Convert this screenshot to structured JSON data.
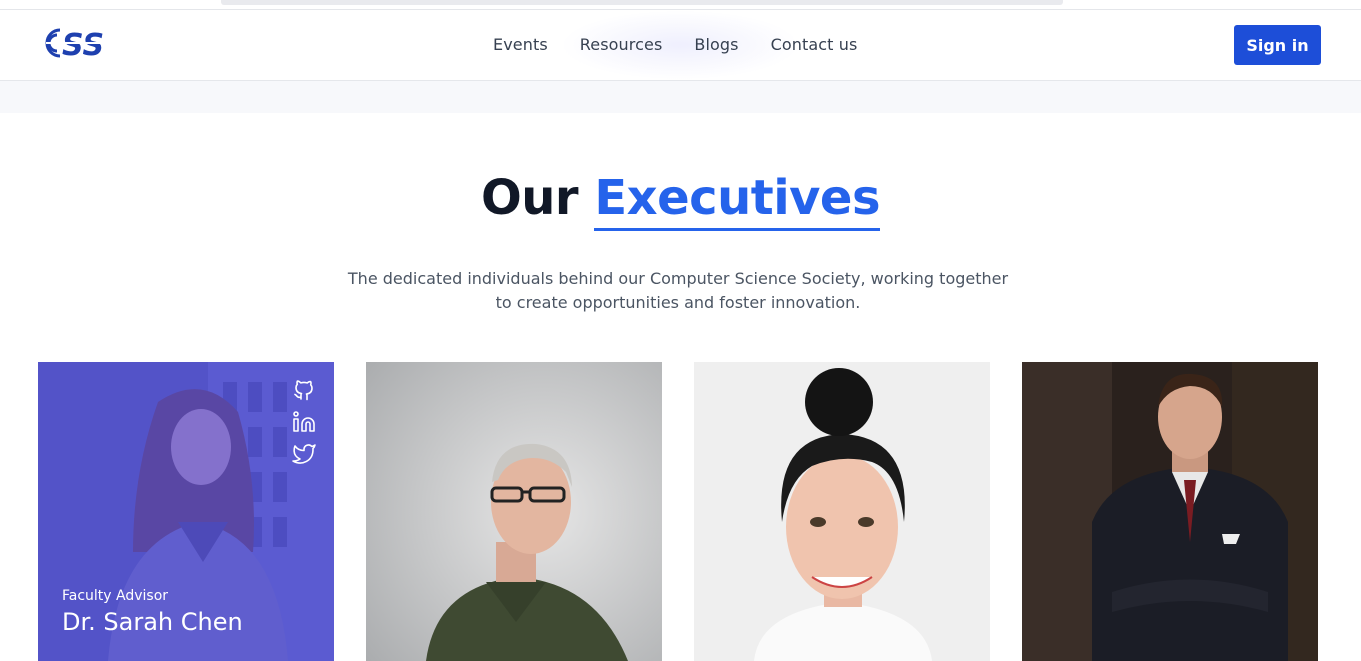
{
  "header": {
    "logo_alt": "CSS",
    "nav": [
      "Events",
      "Resources",
      "Blogs",
      "Contact us"
    ],
    "signin_label": "Sign in"
  },
  "section": {
    "title_plain": "Our",
    "title_accent": "Executives",
    "subtitle_line1": "The dedicated individuals behind our Computer Science Society, working together",
    "subtitle_line2": "to create opportunities and foster innovation."
  },
  "executives": [
    {
      "role": "Faculty Advisor",
      "name": "Dr. Sarah Chen",
      "social": [
        "github-icon",
        "linkedin-icon",
        "twitter-icon"
      ]
    },
    {
      "role": "",
      "name": ""
    },
    {
      "role": "",
      "name": ""
    },
    {
      "role": "",
      "name": ""
    }
  ],
  "colors": {
    "accent": "#2563eb",
    "signin": "#1d4ed8",
    "overlay": "#4f46e5",
    "heading": "#111827"
  }
}
